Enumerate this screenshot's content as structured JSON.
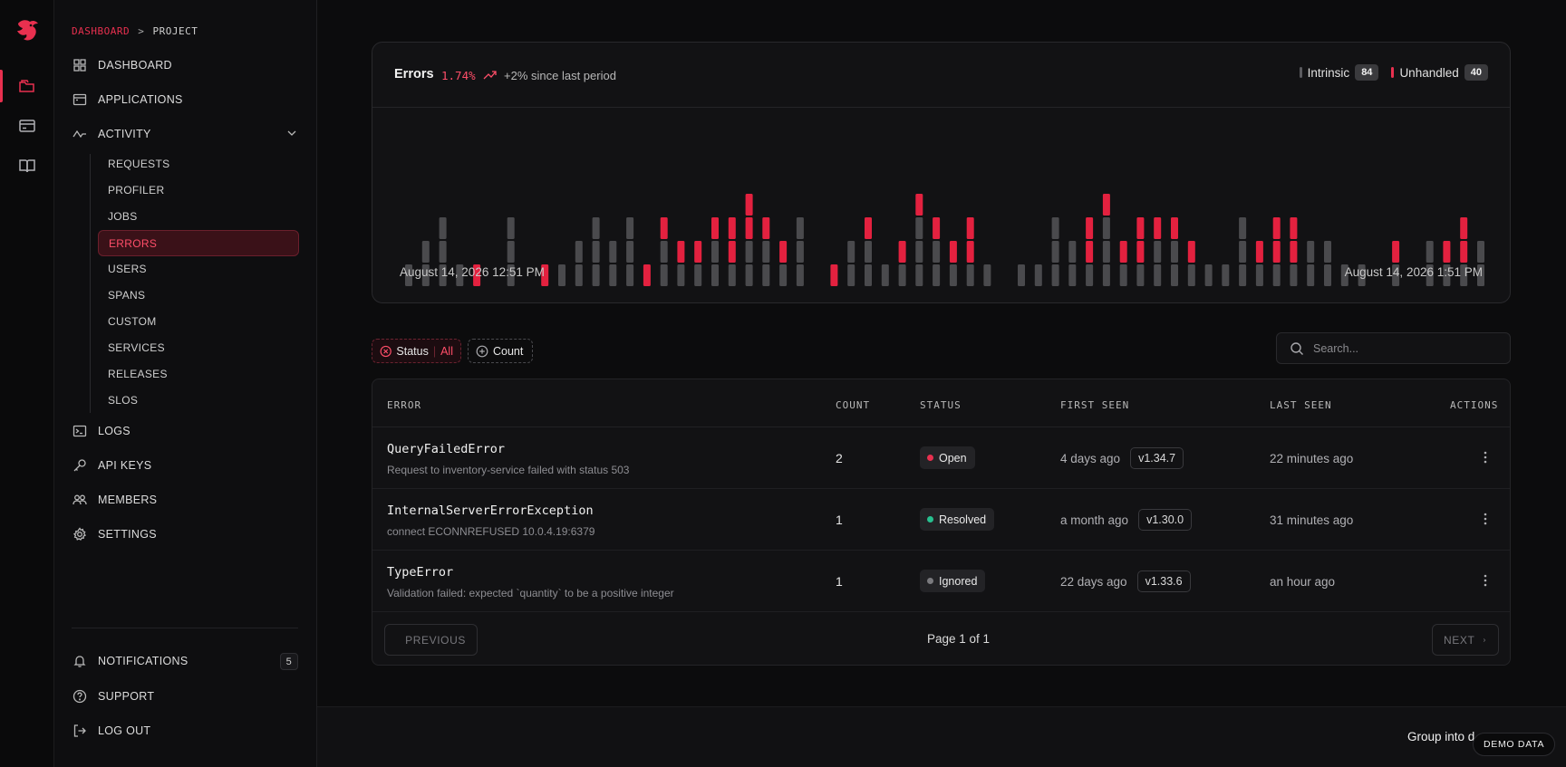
{
  "breadcrumb": {
    "section": "DASHBOARD",
    "separator": ">",
    "page": "PROJECT"
  },
  "nav": {
    "dashboard": "DASHBOARD",
    "applications": "APPLICATIONS",
    "activity": "ACTIVITY",
    "sub": [
      "REQUESTS",
      "PROFILER",
      "JOBS",
      "ERRORS",
      "USERS",
      "SPANS",
      "CUSTOM",
      "SERVICES",
      "RELEASES",
      "SLOS"
    ],
    "active_sub": "ERRORS",
    "logs": "LOGS",
    "api_keys": "API KEYS",
    "members": "MEMBERS",
    "settings": "SETTINGS",
    "notifications": "NOTIFICATIONS",
    "notifications_count": "5",
    "support": "SUPPORT",
    "logout": "LOG OUT"
  },
  "errors_summary": {
    "title": "Errors",
    "percent": "1.74%",
    "change": "+2% since last period",
    "legend_intrinsic": "Intrinsic",
    "intrinsic_count": "84",
    "legend_unhandled": "Unhandled",
    "unhandled_count": "40",
    "start_date": "August 14, 2026 12:51 PM",
    "end_date": "August 14, 2026 1:51 PM"
  },
  "chart_data": {
    "type": "bar",
    "stacked": true,
    "colors": {
      "intrinsic": "#4a4a4d",
      "unhandled": "#e3213f"
    },
    "series": [
      {
        "name": "Intrinsic",
        "values": [
          1,
          2,
          3,
          1,
          0,
          0,
          3,
          0,
          0,
          1,
          2,
          3,
          2,
          3,
          0,
          2,
          1,
          1,
          2,
          1,
          2,
          2,
          1,
          3,
          0,
          0,
          2,
          2,
          1,
          1,
          3,
          2,
          1,
          1,
          1,
          0,
          1,
          1,
          3,
          2,
          1,
          3,
          1,
          1,
          2,
          2,
          1,
          1,
          1,
          3,
          1,
          1,
          1,
          2,
          2,
          1,
          1,
          0,
          1,
          0,
          2,
          1,
          1,
          2
        ]
      },
      {
        "name": "Unhandled",
        "values": [
          0,
          0,
          0,
          0,
          1,
          0,
          0,
          0,
          1,
          0,
          0,
          0,
          0,
          0,
          1,
          1,
          1,
          1,
          1,
          2,
          2,
          1,
          1,
          0,
          0,
          1,
          0,
          1,
          0,
          1,
          1,
          1,
          1,
          2,
          0,
          0,
          0,
          0,
          0,
          0,
          2,
          1,
          1,
          2,
          1,
          1,
          1,
          0,
          0,
          0,
          1,
          2,
          2,
          0,
          0,
          0,
          0,
          0,
          1,
          0,
          0,
          1,
          2,
          0
        ]
      }
    ]
  },
  "filters": {
    "status_label": "Status",
    "status_value": "All",
    "count_label": "Count"
  },
  "search": {
    "placeholder": "Search..."
  },
  "table": {
    "headers": {
      "error": "ERROR",
      "count": "COUNT",
      "status": "STATUS",
      "first_seen": "FIRST SEEN",
      "last_seen": "LAST SEEN",
      "actions": "ACTIONS"
    },
    "rows": [
      {
        "name": "QueryFailedError",
        "desc": "Request to inventory-service failed with status 503",
        "count": "2",
        "status": "Open",
        "status_color": "#e8304f",
        "first_seen": "4 days ago",
        "version": "v1.34.7",
        "last_seen": "22 minutes ago"
      },
      {
        "name": "InternalServerErrorException",
        "desc": "connect ECONNREFUSED 10.0.4.19:6379",
        "count": "1",
        "status": "Resolved",
        "status_color": "#27c08f",
        "first_seen": "a month ago",
        "version": "v1.30.0",
        "last_seen": "31 minutes ago"
      },
      {
        "name": "TypeError",
        "desc": "Validation failed: expected `quantity` to be a positive integer",
        "count": "1",
        "status": "Ignored",
        "status_color": "#7a7a7e",
        "first_seen": "22 days ago",
        "version": "v1.33.6",
        "last_seen": "an hour ago"
      }
    ]
  },
  "pager": {
    "prev": "PREVIOUS",
    "next": "NEXT",
    "page_text": "Page 1 of 1"
  },
  "footer": {
    "group_text": "Group into d",
    "demo_badge": "DEMO DATA"
  }
}
